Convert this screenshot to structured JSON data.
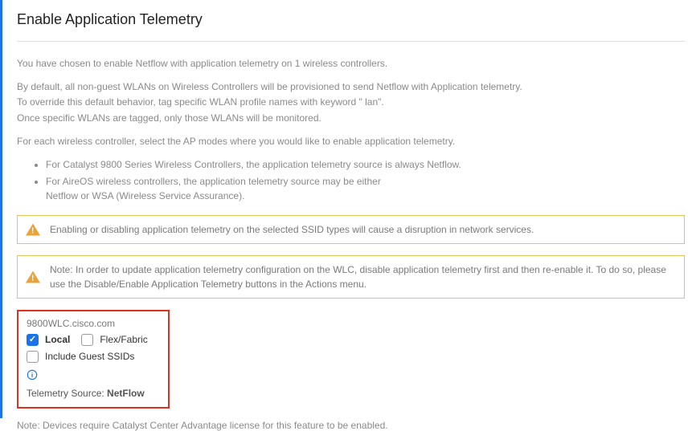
{
  "title": "Enable Application Telemetry",
  "intro": "You have chosen to enable Netflow with application telemetry on 1 wireless controllers.",
  "default_behavior_line1": "By default, all non-guest WLANs on Wireless Controllers will be provisioned to send Netflow with Application telemetry.",
  "default_behavior_line2": "To override this default behavior, tag specific WLAN profile names with keyword \" lan\".",
  "default_behavior_line3": "Once specific WLANs are tagged, only those WLANs will be monitored.",
  "select_modes": "For each wireless controller, select the AP modes where you would like to enable application telemetry.",
  "bullets": {
    "b1": "For Catalyst 9800 Series Wireless Controllers, the application telemetry source is always Netflow.",
    "b2a": "For AireOS wireless controllers, the application telemetry source may be either",
    "b2b": "Netflow or WSA (Wireless Service Assurance)."
  },
  "alert1": "Enabling or disabling application telemetry on the selected SSID types will cause a disruption in network services.",
  "alert2": "Note: In order to update application telemetry configuration on the WLC, disable application telemetry first and then re-enable it. To do so, please use the Disable/Enable Application Telemetry buttons in the Actions menu.",
  "controller": {
    "name": "9800WLC.cisco.com",
    "local_label": "Local",
    "flex_label": "Flex/Fabric",
    "guest_label": "Include Guest SSIDs",
    "local_checked": true,
    "flex_checked": false,
    "guest_checked": false,
    "telemetry_label": "Telemetry Source: ",
    "telemetry_value": "NetFlow"
  },
  "footnote": "Note: Devices require Catalyst Center Advantage license for this feature to be enabled."
}
